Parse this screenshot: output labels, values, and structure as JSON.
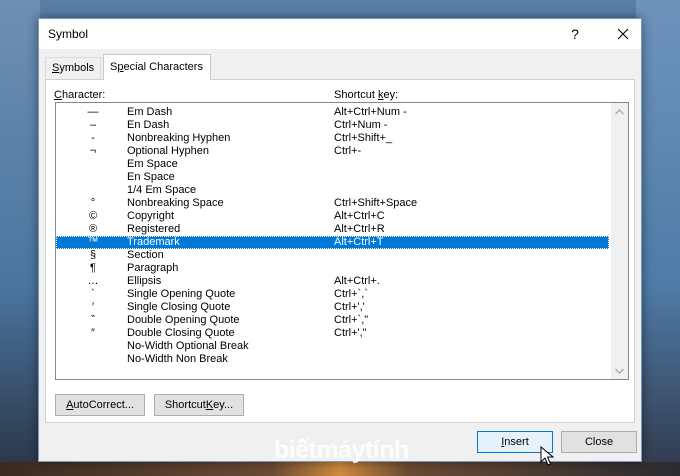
{
  "dialog": {
    "title": "Symbol",
    "help_label": "?"
  },
  "tabs": [
    {
      "label_access": "S",
      "label_rest": "ymbols"
    },
    {
      "label_before": "S",
      "label_access": "p",
      "label_rest": "ecial Characters"
    }
  ],
  "headers": {
    "character_access": "C",
    "character_rest": "haracter:",
    "shortcut_before": "Shortcut ",
    "shortcut_access": "k",
    "shortcut_rest": "ey:"
  },
  "rows": [
    {
      "symbol": "—",
      "name": "Em Dash",
      "key": "Alt+Ctrl+Num -"
    },
    {
      "symbol": "–",
      "name": "En Dash",
      "key": "Ctrl+Num -"
    },
    {
      "symbol": "-",
      "name": "Nonbreaking Hyphen",
      "key": "Ctrl+Shift+_"
    },
    {
      "symbol": "¬",
      "name": "Optional Hyphen",
      "key": "Ctrl+-"
    },
    {
      "symbol": "",
      "name": "Em Space",
      "key": ""
    },
    {
      "symbol": "",
      "name": "En Space",
      "key": ""
    },
    {
      "symbol": "",
      "name": "1/4 Em Space",
      "key": ""
    },
    {
      "symbol": "°",
      "name": "Nonbreaking Space",
      "key": "Ctrl+Shift+Space"
    },
    {
      "symbol": "©",
      "name": "Copyright",
      "key": "Alt+Ctrl+C"
    },
    {
      "symbol": "®",
      "name": "Registered",
      "key": "Alt+Ctrl+R"
    },
    {
      "symbol": "™",
      "name": "Trademark",
      "key": "Alt+Ctrl+T"
    },
    {
      "symbol": "§",
      "name": "Section",
      "key": ""
    },
    {
      "symbol": "¶",
      "name": "Paragraph",
      "key": ""
    },
    {
      "symbol": "…",
      "name": "Ellipsis",
      "key": "Alt+Ctrl+."
    },
    {
      "symbol": "`",
      "name": "Single Opening Quote",
      "key": "Ctrl+`,`"
    },
    {
      "symbol": "′",
      "name": "Single Closing Quote",
      "key": "Ctrl+','"
    },
    {
      "symbol": "‶",
      "name": "Double Opening Quote",
      "key": "Ctrl+`,\""
    },
    {
      "symbol": "″",
      "name": "Double Closing Quote",
      "key": "Ctrl+',\""
    },
    {
      "symbol": "",
      "name": "No-Width Optional Break",
      "key": ""
    },
    {
      "symbol": "",
      "name": "No-Width Non Break",
      "key": ""
    }
  ],
  "selected_row": "Trademark",
  "buttons": {
    "autocorrect_access": "A",
    "autocorrect_rest": "utoCorrect...",
    "shortcut_before": "Shortcut ",
    "shortcut_access": "K",
    "shortcut_rest": "ey...",
    "insert_access": "I",
    "insert_rest": "nsert",
    "close": "Close"
  },
  "watermark": "biếtmáytính",
  "colors": {
    "selection": "#0078d7",
    "default_button_border": "#0078d7"
  },
  "icons": [
    "close-icon",
    "scroll-up-icon",
    "scroll-down-icon",
    "mouse-cursor-icon"
  ]
}
